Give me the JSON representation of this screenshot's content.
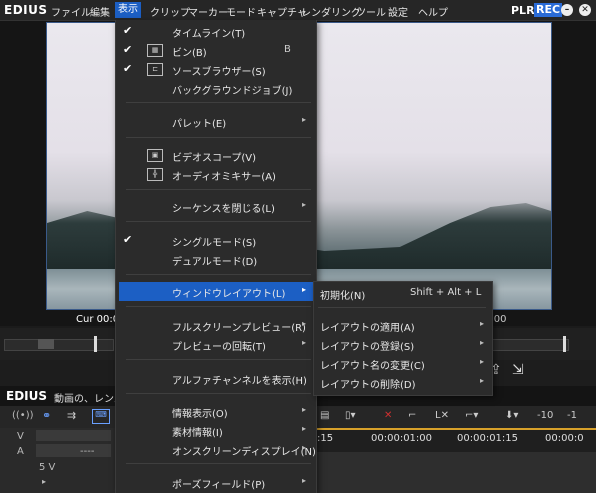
{
  "app": {
    "logo": "EDIUS",
    "plr": "PLR",
    "rec": "REC"
  },
  "menubar": [
    "ファイル",
    "編集",
    "表示",
    "クリップ",
    "マーカー",
    "モード",
    "キャプチャ",
    "レンダリング",
    "ツール",
    "設定",
    "ヘルプ"
  ],
  "preview": {
    "tc_left": "Cur 00:0",
    "tc_right": "5:00"
  },
  "timeline": {
    "title": "EDIUS",
    "sequence": "動画の、レンズの",
    "ruler": [
      ":15",
      "00:00:01:00",
      "00:00:01:15",
      "00:00:0"
    ],
    "tracks": {
      "v": "V",
      "a": "A",
      "sv": "5 V"
    },
    "a_value": "----",
    "tools": [
      "-10",
      "-1"
    ]
  },
  "menu": {
    "items": [
      {
        "label": "タイムライン(T)",
        "check": "✔"
      },
      {
        "label": "ビン(B)",
        "check": "✔",
        "icon": "▦",
        "shortcut": "B"
      },
      {
        "label": "ソースブラウザー(S)",
        "check": "✔",
        "icon": "⊏"
      },
      {
        "label": "バックグラウンドジョブ(J)"
      },
      {
        "label": "パレット(E)",
        "arrow": "▸"
      },
      {
        "label": "ビデオスコープ(V)",
        "icon": "▣"
      },
      {
        "label": "オーディオミキサー(A)",
        "icon": "╬"
      },
      {
        "label": "シーケンスを閉じる(L)",
        "arrow": "▸"
      },
      {
        "label": "シングルモード(S)",
        "check": "✔"
      },
      {
        "label": "デュアルモード(D)"
      },
      {
        "label": "ウィンドウレイアウト(L)",
        "arrow": "▸"
      },
      {
        "label": "フルスクリーンプレビュー(R)",
        "arrow": "▸"
      },
      {
        "label": "プレビューの回転(T)",
        "arrow": "▸"
      },
      {
        "label": "アルファチャンネルを表示(H)"
      },
      {
        "label": "情報表示(O)",
        "arrow": "▸"
      },
      {
        "label": "素材情報(I)",
        "arrow": "▸"
      },
      {
        "label": "オンスクリーンディスプレイ(N)",
        "arrow": "▸"
      },
      {
        "label": "ポーズフィールド(P)",
        "arrow": "▸"
      }
    ]
  },
  "submenu": {
    "items": [
      {
        "label": "初期化(N)",
        "shortcut": "Shift + Alt + L"
      },
      {
        "label": "レイアウトの適用(A)",
        "arrow": "▸"
      },
      {
        "label": "レイアウトの登録(S)",
        "arrow": "▸"
      },
      {
        "label": "レイアウト名の変更(C)",
        "arrow": "▸"
      },
      {
        "label": "レイアウトの削除(D)",
        "arrow": "▸"
      }
    ]
  }
}
